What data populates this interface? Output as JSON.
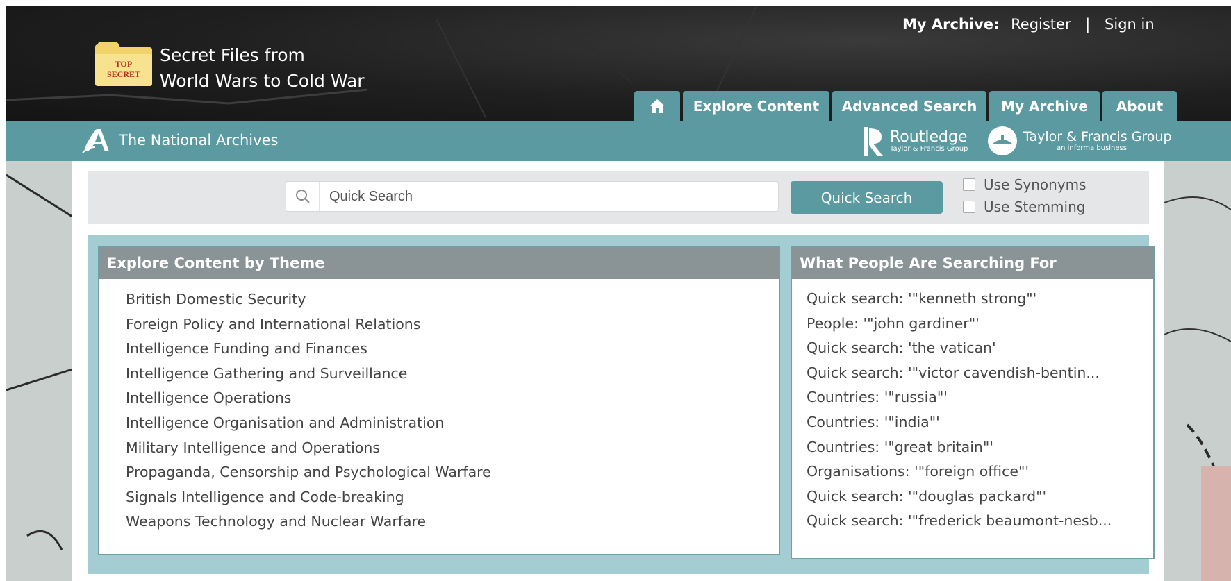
{
  "header": {
    "logo_text": "TOP SECRET",
    "title_line1": "Secret Files from",
    "title_line2": "World Wars to Cold War",
    "my_archive_label": "My Archive:",
    "register": "Register",
    "separator": "|",
    "sign_in": "Sign in"
  },
  "tabs": [
    {
      "label": "",
      "icon": "home-icon"
    },
    {
      "label": "Explore Content"
    },
    {
      "label": "Advanced Search"
    },
    {
      "label": "My Archive"
    },
    {
      "label": "About"
    }
  ],
  "brand_bar": {
    "tna": "The National Archives",
    "routledge": "Routledge",
    "routledge_sub": "Taylor & Francis Group",
    "tf": "Taylor & Francis Group",
    "tf_sub": "an informa business"
  },
  "search": {
    "placeholder": "Quick Search",
    "button": "Quick Search",
    "use_synonyms": "Use Synonyms",
    "use_stemming": "Use Stemming"
  },
  "themes": {
    "heading": "Explore Content by Theme",
    "items": [
      "British Domestic Security",
      "Foreign Policy and International Relations",
      "Intelligence Funding and Finances",
      "Intelligence Gathering and Surveillance",
      "Intelligence Operations",
      "Intelligence Organisation and Administration",
      "Military Intelligence and Operations",
      "Propaganda, Censorship and Psychological Warfare",
      "Signals Intelligence and Code-breaking",
      "Weapons Technology and Nuclear Warfare"
    ]
  },
  "searching": {
    "heading": "What People Are Searching For",
    "items": [
      "Quick search: '\"kenneth strong\"'",
      "People: '\"john gardiner\"'",
      "Quick search: 'the vatican'",
      "Quick search: '\"victor cavendish-bentin...",
      "Countries: '\"russia\"'",
      "Countries: '\"india\"'",
      "Countries: '\"great britain\"'",
      "Organisations: '\"foreign office\"'",
      "Quick search: '\"douglas packard\"'",
      "Quick search: '\"frederick beaumont-nesb..."
    ]
  },
  "colors": {
    "accent": "#5b9aa0",
    "panel_bg": "#a3cdd2",
    "panel_head": "#8a9396",
    "header_bg": "#1f1f1f"
  }
}
